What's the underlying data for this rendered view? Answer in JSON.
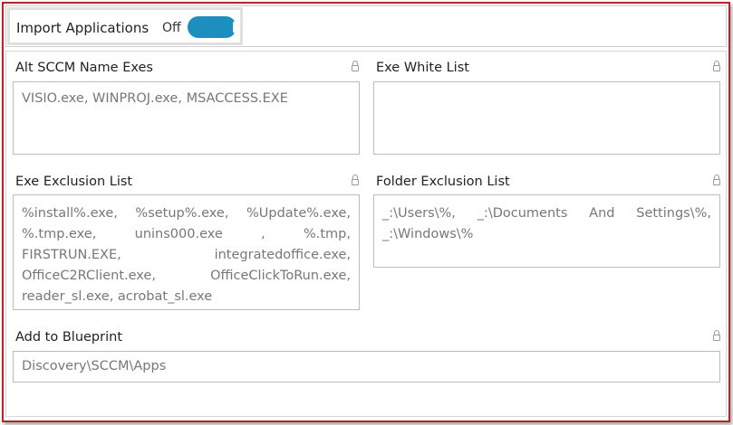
{
  "import_applications": {
    "label": "Import Applications",
    "state_label": "Off"
  },
  "fields": {
    "alt_sccm_name_exes": {
      "label": "Alt SCCM Name Exes",
      "value": "VISIO.exe, WINPROJ.exe, MSACCESS.EXE"
    },
    "exe_white_list": {
      "label": "Exe White List",
      "value": ""
    },
    "exe_exclusion_list": {
      "label": "Exe Exclusion List",
      "value": "%install%.exe, %setup%.exe, %Update%.exe, %.tmp.exe, unins000.exe , %.tmp, FIRSTRUN.EXE, integratedoffice.exe, OfficeC2RClient.exe, OfficeClickToRun.exe, reader_sl.exe, acrobat_sl.exe"
    },
    "folder_exclusion_list": {
      "label": "Folder Exclusion List",
      "value": "_:\\Users\\%, _:\\Documents And Settings\\%, _:\\Windows\\%"
    },
    "add_to_blueprint": {
      "label": "Add to Blueprint",
      "value": "Discovery\\SCCM\\Apps"
    }
  },
  "colors": {
    "toggle": "#1c8ebf",
    "frame_border": "#b3262a"
  },
  "icons": {
    "field_lock": "lock-icon"
  }
}
